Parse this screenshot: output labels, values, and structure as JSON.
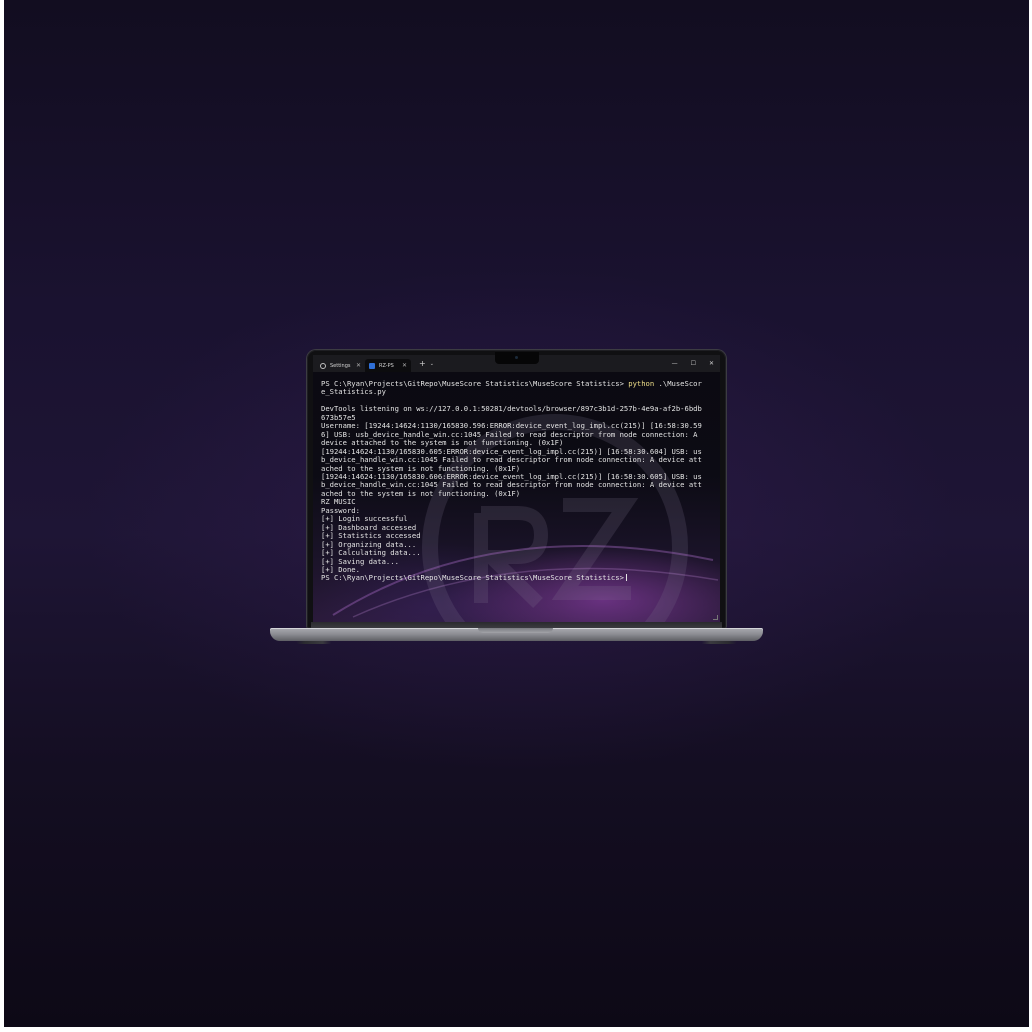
{
  "terminal": {
    "tabs": [
      {
        "label": "Settings",
        "icon": "gear-icon"
      },
      {
        "label": "RZ-PS",
        "icon": "powershell-icon"
      }
    ],
    "new_tab_symbol": "+",
    "dropdown_symbol": "⌄",
    "close_symbol": "✕",
    "window_controls": {
      "minimize": "—",
      "maximize": "☐",
      "close": "✕"
    },
    "prompt": "PS C:\\Ryan\\Projects\\GitRepo\\MuseScore Statistics\\MuseScore Statistics>",
    "command": "python",
    "argument": ".\\MuseScore_Statistics.py",
    "output_lines": [
      "",
      "DevTools listening on ws://127.0.0.1:50281/devtools/browser/897c3b1d-257b-4e9a-af2b-6bdb",
      "673b57e5",
      "Username: [19244:14624:1130/165830.596:ERROR:device_event_log_impl.cc(215)] [16:58:30.59",
      "6] USB: usb_device_handle_win.cc:1045 Failed to read descriptor from node connection: A",
      "device attached to the system is not functioning. (0x1F)",
      "[19244:14624:1130/165830.605:ERROR:device_event_log_impl.cc(215)] [16:58:30.604] USB: us",
      "b_device_handle_win.cc:1045 Failed to read descriptor from node connection: A device att",
      "ached to the system is not functioning. (0x1F)",
      "[19244:14624:1130/165830.606:ERROR:device_event_log_impl.cc(215)] [16:58:30.605] USB: us",
      "b_device_handle_win.cc:1045 Failed to read descriptor from node connection: A device att",
      "ached to the system is not functioning. (0x1F)",
      "RZ MUSIC",
      "Password:",
      "[+] Login successful",
      "[+] Dashboard accessed",
      "[+] Statistics accessed",
      "[+] Organizing data...",
      "[+] Calculating data...",
      "[+] Saving data...",
      "[+] Done."
    ],
    "final_prompt": "PS C:\\Ryan\\Projects\\GitRepo\\MuseScore Statistics\\MuseScore Statistics>"
  },
  "colors": {
    "command": "#f0df8a",
    "text": "#e4e4e4",
    "titlebar": "#1b1b1f"
  }
}
